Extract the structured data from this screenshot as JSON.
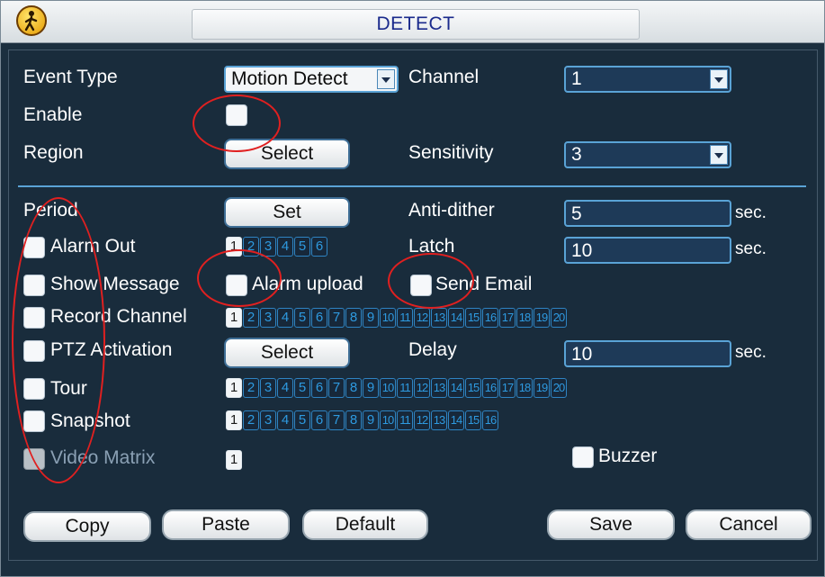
{
  "window": {
    "title": "DETECT",
    "title_icon": "person-walking-icon"
  },
  "event_type": {
    "label": "Event Type",
    "value": "Motion Detect"
  },
  "channel": {
    "label": "Channel",
    "value": "1"
  },
  "enable": {
    "label": "Enable",
    "checked": false
  },
  "region": {
    "label": "Region",
    "button": "Select"
  },
  "sensitivity": {
    "label": "Sensitivity",
    "value": "3"
  },
  "period": {
    "label": "Period",
    "button": "Set"
  },
  "anti_dither": {
    "label": "Anti-dither",
    "value": "5",
    "unit": "sec."
  },
  "alarm_out": {
    "label": "Alarm Out",
    "outputs": [
      "1",
      "2",
      "3",
      "4",
      "5",
      "6"
    ],
    "selected": [
      "1"
    ]
  },
  "latch": {
    "label": "Latch",
    "value": "10",
    "unit": "sec."
  },
  "show_message": {
    "label": "Show Message"
  },
  "alarm_upload": {
    "label": "Alarm upload"
  },
  "send_email": {
    "label": "Send Email"
  },
  "record_channel": {
    "label": "Record Channel",
    "channels": [
      "1",
      "2",
      "3",
      "4",
      "5",
      "6",
      "7",
      "8",
      "9",
      "10",
      "11",
      "12",
      "13",
      "14",
      "15",
      "16",
      "17",
      "18",
      "19",
      "20"
    ],
    "selected": [
      "1"
    ]
  },
  "ptz_activation": {
    "label": "PTZ Activation",
    "button": "Select"
  },
  "delay": {
    "label": "Delay",
    "value": "10",
    "unit": "sec."
  },
  "tour": {
    "label": "Tour",
    "channels": [
      "1",
      "2",
      "3",
      "4",
      "5",
      "6",
      "7",
      "8",
      "9",
      "10",
      "11",
      "12",
      "13",
      "14",
      "15",
      "16",
      "17",
      "18",
      "19",
      "20"
    ],
    "selected": [
      "1"
    ]
  },
  "snapshot": {
    "label": "Snapshot",
    "channels": [
      "1",
      "2",
      "3",
      "4",
      "5",
      "6",
      "7",
      "8",
      "9",
      "10",
      "11",
      "12",
      "13",
      "14",
      "15",
      "16"
    ],
    "selected": [
      "1"
    ]
  },
  "video_matrix": {
    "label": "Video Matrix",
    "channels": [
      "1"
    ],
    "selected": [
      "1"
    ]
  },
  "buzzer": {
    "label": "Buzzer"
  },
  "buttons": {
    "copy": "Copy",
    "paste": "Paste",
    "default": "Default",
    "save": "Save",
    "cancel": "Cancel"
  },
  "colors": {
    "panel_bg": "#192c3c",
    "accent": "#5aa3d6",
    "title_text": "#1a2a8c",
    "annotation_red": "#e02020"
  }
}
